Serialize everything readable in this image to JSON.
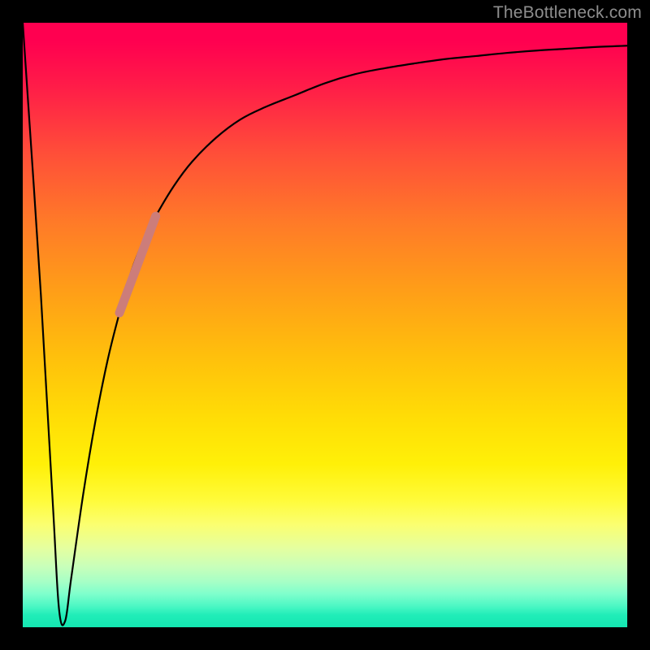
{
  "watermark": {
    "text": "TheBottleneck.com"
  },
  "colors": {
    "page_bg": "#000000",
    "curve": "#000000",
    "highlight": "#cc7d7a",
    "watermark": "#8e8e8e"
  },
  "chart_data": {
    "type": "line",
    "title": "",
    "xlabel": "",
    "ylabel": "",
    "xlim": [
      0,
      100
    ],
    "ylim": [
      0,
      100
    ],
    "grid": false,
    "legend": false,
    "series": [
      {
        "name": "bottleneck-curve",
        "x": [
          0,
          3,
          5,
          6,
          7,
          8,
          10,
          12,
          14,
          16,
          18,
          20,
          22,
          25,
          28,
          32,
          36,
          40,
          45,
          50,
          55,
          60,
          65,
          70,
          75,
          80,
          85,
          90,
          95,
          100
        ],
        "values": [
          100,
          55,
          20,
          3,
          1,
          8,
          22,
          34,
          44,
          52,
          59,
          64,
          68,
          73,
          77,
          81,
          84,
          86,
          88,
          90,
          91.5,
          92.5,
          93.3,
          94,
          94.5,
          95,
          95.4,
          95.7,
          96,
          96.2
        ]
      },
      {
        "name": "highlight-segment",
        "x": [
          16,
          22
        ],
        "values": [
          52,
          68
        ]
      }
    ],
    "annotations": []
  }
}
